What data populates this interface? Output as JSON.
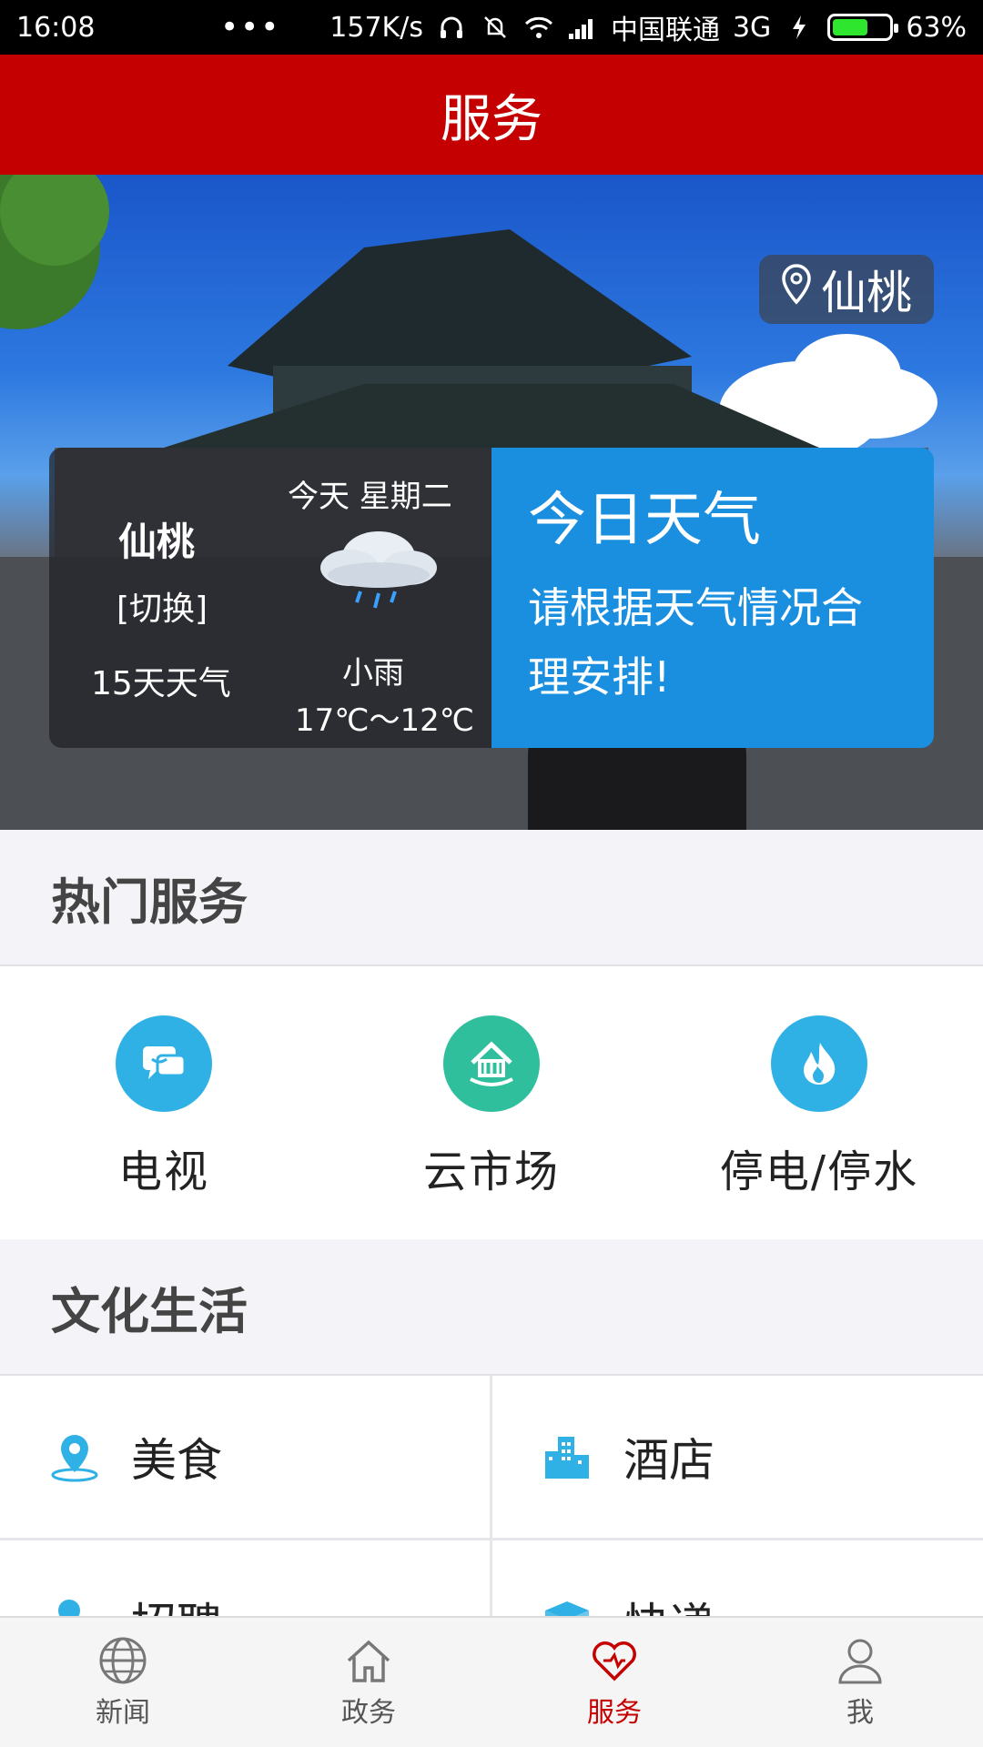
{
  "status_bar": {
    "time": "16:08",
    "dots": "•••",
    "speed": "157K/s",
    "carrier": "中国联通",
    "network": "3G",
    "battery_pct": "63%",
    "battery_level": 0.63
  },
  "header": {
    "title": "服务"
  },
  "hero": {
    "location": "仙桃",
    "weather": {
      "city": "仙桃",
      "switch": "[切换]",
      "forecast_link": "15天天气",
      "today": "今天  星期二",
      "condition": "小雨",
      "temp": "17℃～12℃",
      "panel_title": "今日天气",
      "panel_msg": "请根据天气情况合理安排!"
    }
  },
  "hot_services": {
    "title": "热门服务",
    "items": [
      {
        "label": "电视",
        "icon": "tv-chat-icon",
        "color": "#2fb1e6"
      },
      {
        "label": "云市场",
        "icon": "market-icon",
        "color": "#2fbf9c"
      },
      {
        "label": "停电/停水",
        "icon": "fire-icon",
        "color": "#2fb1e6"
      }
    ]
  },
  "culture": {
    "title": "文化生活",
    "items": [
      {
        "label": "美食",
        "icon": "location-pin-icon"
      },
      {
        "label": "酒店",
        "icon": "building-icon"
      },
      {
        "label": "招聘",
        "icon": "person-icon"
      },
      {
        "label": "快递",
        "icon": "package-icon"
      }
    ]
  },
  "tabbar": {
    "items": [
      {
        "label": "新闻",
        "icon": "globe-icon"
      },
      {
        "label": "政务",
        "icon": "home-icon"
      },
      {
        "label": "服务",
        "icon": "heart-icon"
      },
      {
        "label": "我",
        "icon": "user-icon"
      }
    ],
    "active_color": "#c40000"
  }
}
